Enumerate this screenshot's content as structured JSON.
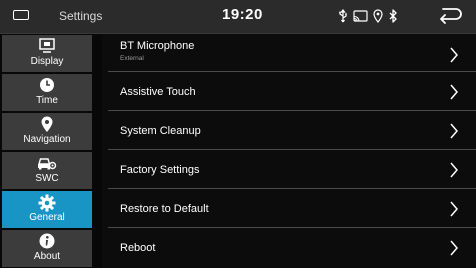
{
  "statusbar": {
    "title": "Settings",
    "time": "19:20",
    "icons": [
      "usb-icon",
      "screen-mirror-icon",
      "location-icon",
      "bluetooth-icon"
    ],
    "home_icon": "home-icon",
    "back_icon": "back-arrow-icon"
  },
  "sidebar": {
    "items": [
      {
        "label": "Display",
        "icon": "display-icon",
        "active": false
      },
      {
        "label": "Time",
        "icon": "clock-icon",
        "active": false
      },
      {
        "label": "Navigation",
        "icon": "location-pin-icon",
        "active": false
      },
      {
        "label": "SWC",
        "icon": "car-settings-icon",
        "active": false
      },
      {
        "label": "General",
        "icon": "gear-icon",
        "active": true
      },
      {
        "label": "About",
        "icon": "info-icon",
        "active": false
      }
    ]
  },
  "settings": {
    "items": [
      {
        "label": "BT Microphone",
        "value": "External"
      },
      {
        "label": "Assistive Touch"
      },
      {
        "label": "System Cleanup"
      },
      {
        "label": "Factory Settings"
      },
      {
        "label": "Restore to Default"
      },
      {
        "label": "Reboot"
      }
    ]
  },
  "colors": {
    "accent": "#1995c5",
    "sidebar_item": "#3c3c3c",
    "statusbar": "#2b2b2b",
    "background": "#0c0c0c",
    "divider": "#4a4a4a"
  }
}
